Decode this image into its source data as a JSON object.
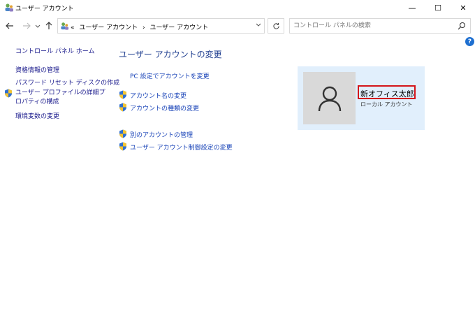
{
  "window": {
    "title": "ユーザー アカウント",
    "minimize": "—",
    "maximize": "☐",
    "close": "✕"
  },
  "address": {
    "prefix": "«",
    "crumb1": "ユーザー アカウント",
    "separator": "›",
    "crumb2": "ユーザー アカウント"
  },
  "search": {
    "placeholder": "コントロール パネルの検索"
  },
  "help": "?",
  "left_pane": {
    "home": "コントロール パネル ホーム",
    "items": [
      "資格情報の管理",
      "パスワード リセット ディスクの作成",
      "ユーザー プロファイルの詳細プロパティの構成",
      "環境変数の変更"
    ]
  },
  "main": {
    "title": "ユーザー アカウントの変更",
    "pc_settings": "PC 設定でアカウントを変更",
    "change_name": "アカウント名の変更",
    "change_type": "アカウントの種類の変更",
    "manage_other": "別のアカウントの管理",
    "uac_settings": "ユーザー アカウント制御設定の変更"
  },
  "account": {
    "name": "新オフィス太郎",
    "type": "ローカル アカウント"
  },
  "colors": {
    "link": "#1a44b8",
    "card_bg": "#e1effc",
    "highlight": "#d4141a"
  }
}
